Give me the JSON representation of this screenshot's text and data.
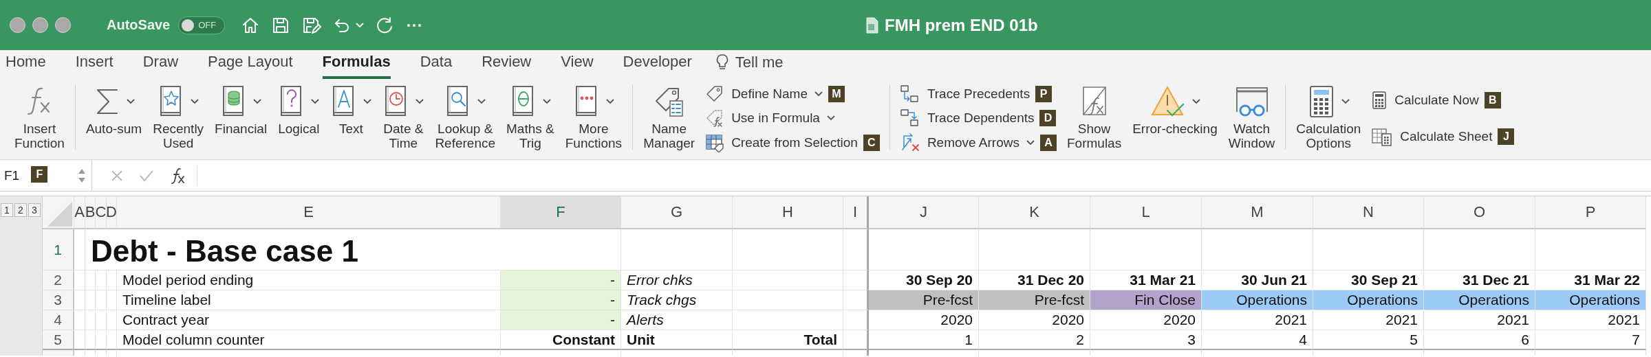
{
  "window": {
    "title": "FMH prem END 01b",
    "autosave": {
      "label": "AutoSave",
      "on": false,
      "state": "OFF"
    }
  },
  "menu_tabs": [
    {
      "label": "Home",
      "selected": false
    },
    {
      "label": "Insert",
      "selected": false
    },
    {
      "label": "Draw",
      "selected": false
    },
    {
      "label": "Page Layout",
      "selected": false
    },
    {
      "label": "Formulas",
      "selected": true
    },
    {
      "label": "Data",
      "selected": false
    },
    {
      "label": "Review",
      "selected": false
    },
    {
      "label": "View",
      "selected": false
    },
    {
      "label": "Developer",
      "selected": false
    }
  ],
  "tell_me": "Tell me",
  "ribbon": {
    "groups": [
      [
        {
          "kind": "large",
          "label": "Insert\nFunction",
          "dropdown": false,
          "keytip": "F"
        }
      ],
      [
        {
          "kind": "large",
          "label": "Auto-sum",
          "dropdown": true
        },
        {
          "kind": "large",
          "label": "Recently\nUsed",
          "dropdown": true
        },
        {
          "kind": "large",
          "label": "Financial",
          "dropdown": true
        },
        {
          "kind": "large",
          "label": "Logical",
          "dropdown": true
        },
        {
          "kind": "large",
          "label": "Text",
          "dropdown": true
        },
        {
          "kind": "large",
          "label": "Date &\nTime",
          "dropdown": true
        },
        {
          "kind": "large",
          "label": "Lookup &\nReference",
          "dropdown": true
        },
        {
          "kind": "large",
          "label": "Maths &\nTrig",
          "dropdown": true
        },
        {
          "kind": "large",
          "label": "More\nFunctions",
          "dropdown": true
        }
      ],
      [
        {
          "kind": "large",
          "label": "Name\nManager",
          "dropdown": false
        },
        {
          "kind": "stack",
          "items": [
            {
              "label": "Define Name",
              "dropdown": true,
              "keytip": "M"
            },
            {
              "label": "Use in Formula",
              "dropdown": true
            },
            {
              "label": "Create from Selection",
              "dropdown": false,
              "keytip": "C"
            }
          ]
        }
      ],
      [
        {
          "kind": "stack",
          "items": [
            {
              "label": "Trace Precedents",
              "dropdown": false,
              "keytip": "P"
            },
            {
              "label": "Trace Dependents",
              "dropdown": false,
              "keytip": "D"
            },
            {
              "label": "Remove Arrows",
              "dropdown": true,
              "keytip": "A"
            }
          ]
        },
        {
          "kind": "large",
          "label": "Show\nFormulas",
          "dropdown": false
        },
        {
          "kind": "large",
          "label": "Error-checking",
          "dropdown": true
        },
        {
          "kind": "large",
          "label": "Watch\nWindow",
          "dropdown": false
        }
      ],
      [
        {
          "kind": "large",
          "label": "Calculation\nOptions",
          "dropdown": true
        },
        {
          "kind": "stack",
          "items": [
            {
              "label": "Calculate Now",
              "dropdown": false,
              "keytip": "B"
            },
            {
              "label": "Calculate Sheet",
              "dropdown": false,
              "keytip": "J"
            }
          ]
        }
      ]
    ]
  },
  "formula_bar": {
    "name_box": "F1"
  },
  "sheet": {
    "outline_levels": [
      "1",
      "2",
      "3"
    ],
    "columns": [
      {
        "label": "A",
        "selected": false
      },
      {
        "label": "B",
        "selected": false
      },
      {
        "label": "C",
        "selected": false
      },
      {
        "label": "D",
        "selected": false
      },
      {
        "label": "E",
        "selected": false
      },
      {
        "label": "F",
        "selected": true
      },
      {
        "label": "G",
        "selected": false
      },
      {
        "label": "H",
        "selected": false
      },
      {
        "label": "I",
        "selected": false
      },
      {
        "label": "J",
        "selected": false
      },
      {
        "label": "K",
        "selected": false
      },
      {
        "label": "L",
        "selected": false
      },
      {
        "label": "M",
        "selected": false
      },
      {
        "label": "N",
        "selected": false
      },
      {
        "label": "O",
        "selected": false
      },
      {
        "label": "P",
        "selected": false
      }
    ],
    "rows": [
      {
        "number": "1",
        "selected": true,
        "kind": "title",
        "label": "Debt - Base case 1"
      },
      {
        "number": "2",
        "selected": false,
        "kind": "data",
        "label": "Model period ending",
        "constant": "-",
        "input": true,
        "unit": "Error chks",
        "timeline_bold": true,
        "timeline": [
          {
            "text": "30 Sep 20"
          },
          {
            "text": "31 Dec 20"
          },
          {
            "text": "31 Mar 21"
          },
          {
            "text": "30 Jun 21"
          },
          {
            "text": "30 Sep 21"
          },
          {
            "text": "31 Dec 21"
          },
          {
            "text": "31 Mar 22"
          }
        ]
      },
      {
        "number": "3",
        "selected": false,
        "kind": "data",
        "label": "Timeline label",
        "constant": "-",
        "input": true,
        "unit": "Track chgs",
        "timeline_bold": false,
        "timeline": [
          {
            "text": "Pre-fcst",
            "color": "#c0c0c0"
          },
          {
            "text": "Pre-fcst",
            "color": "#c0c0c0"
          },
          {
            "text": "Fin Close",
            "color": "#b3a2cc"
          },
          {
            "text": "Operations",
            "color": "#9dcbf8"
          },
          {
            "text": "Operations",
            "color": "#9dcbf8"
          },
          {
            "text": "Operations",
            "color": "#9dcbf8"
          },
          {
            "text": "Operations",
            "color": "#9dcbf8"
          }
        ]
      },
      {
        "number": "4",
        "selected": false,
        "kind": "data",
        "label": "Contract year",
        "constant": "-",
        "input": true,
        "unit": "Alerts",
        "timeline_bold": false,
        "timeline": [
          {
            "text": "2020"
          },
          {
            "text": "2020"
          },
          {
            "text": "2020"
          },
          {
            "text": "2021"
          },
          {
            "text": "2021"
          },
          {
            "text": "2021"
          },
          {
            "text": "2021"
          }
        ]
      },
      {
        "number": "5",
        "selected": false,
        "kind": "header",
        "label": "Model column counter",
        "constant": "Constant",
        "input": false,
        "unit": "Unit",
        "total": "Total",
        "timeline_bold": false,
        "timeline": [
          {
            "text": "1"
          },
          {
            "text": "2"
          },
          {
            "text": "3"
          },
          {
            "text": "4"
          },
          {
            "text": "5"
          },
          {
            "text": "6"
          },
          {
            "text": "7"
          }
        ]
      }
    ]
  }
}
